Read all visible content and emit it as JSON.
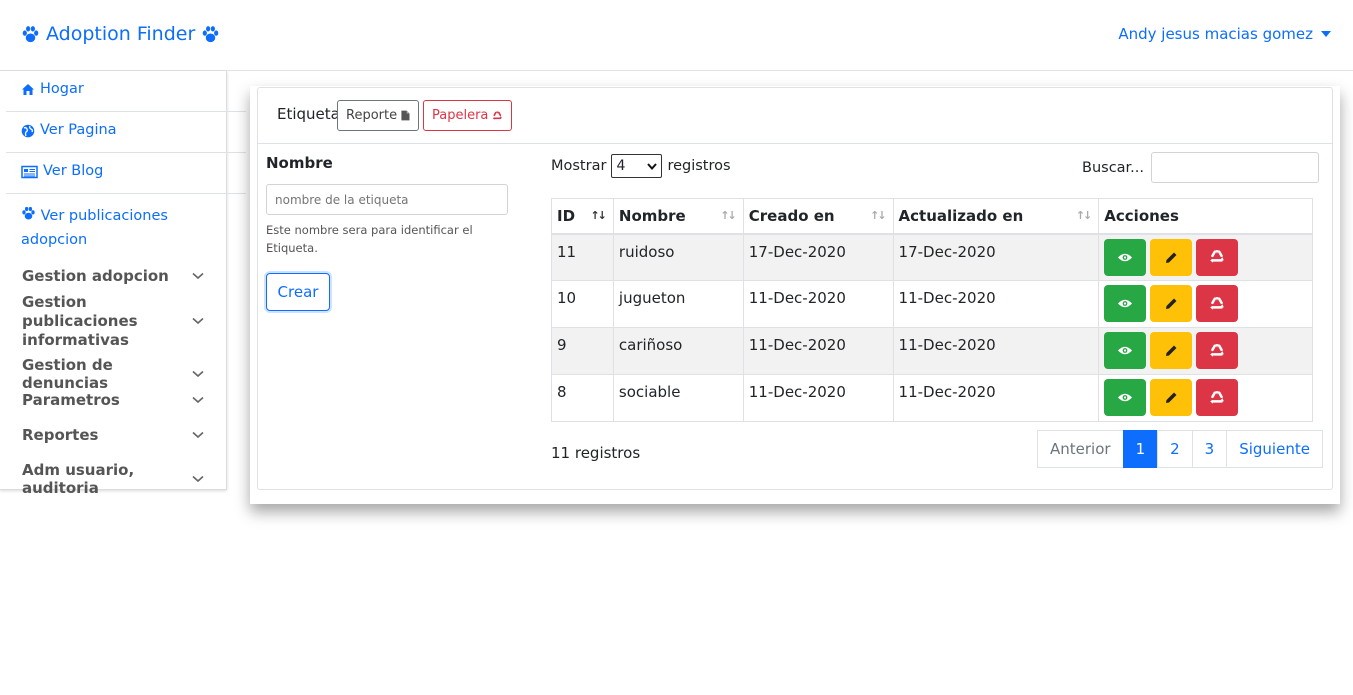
{
  "navbar": {
    "brand": "Adoption Finder",
    "user": "Andy jesus macias gomez"
  },
  "sidebar": {
    "links": [
      {
        "label": "Hogar",
        "icon": "home-icon"
      },
      {
        "label": "Ver Pagina",
        "icon": "globe-icon"
      },
      {
        "label": "Ver Blog",
        "icon": "newspaper-icon"
      },
      {
        "label": "Ver publicaciones adopcion",
        "icon": "paw-icon"
      }
    ],
    "groups": [
      "Gestion adopcion",
      "Gestion publicaciones informativas",
      "Gestion de denuncias",
      "Parametros",
      "Reportes",
      "Adm usuario, auditoria"
    ]
  },
  "header": {
    "title": "Etiqueta",
    "reporte": "Reporte",
    "papelera": "Papelera"
  },
  "form": {
    "label": "Nombre",
    "placeholder": "nombre de la etiqueta",
    "help": "Este nombre sera para identificar el Etiqueta.",
    "submit": "Crear"
  },
  "list": {
    "show_prefix": "Mostrar",
    "show_value": "4",
    "show_suffix": "registros",
    "search_label": "Buscar...",
    "columns": [
      "ID",
      "Nombre",
      "Creado en",
      "Actualizado en",
      "Acciones"
    ],
    "rows": [
      {
        "id": "11",
        "nombre": "ruidoso",
        "creado": "17-Dec-2020",
        "actualizado": "17-Dec-2020"
      },
      {
        "id": "10",
        "nombre": "jugueton",
        "creado": "11-Dec-2020",
        "actualizado": "11-Dec-2020"
      },
      {
        "id": "9",
        "nombre": "cariñoso",
        "creado": "11-Dec-2020",
        "actualizado": "11-Dec-2020"
      },
      {
        "id": "8",
        "nombre": "sociable",
        "creado": "11-Dec-2020",
        "actualizado": "11-Dec-2020"
      }
    ],
    "info": "11 registros",
    "pager": {
      "prev": "Anterior",
      "pages": [
        "1",
        "2",
        "3"
      ],
      "active": "1",
      "next": "Siguiente"
    }
  },
  "colors": {
    "primary": "#0d6efd",
    "success": "#28a745",
    "warning": "#ffc107",
    "danger": "#dc3545"
  }
}
